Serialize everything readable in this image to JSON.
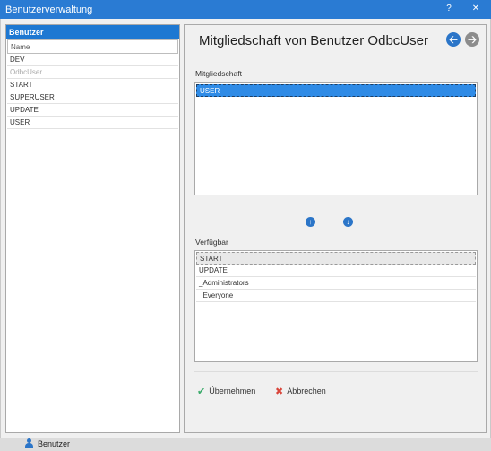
{
  "window": {
    "title": "Benutzerverwaltung",
    "help_label": "?",
    "close_label": "✕"
  },
  "left": {
    "header": "Benutzer",
    "column_header": "Name",
    "rows": [
      "DEV",
      "OdbcUser",
      "START",
      "SUPERUSER",
      "UPDATE",
      "USER"
    ]
  },
  "right": {
    "title": "Mitgliedschaft von Benutzer OdbcUser",
    "nav_back": "🡠",
    "nav_forward": "🡢",
    "membership_label": "Mitgliedschaft",
    "membership_items": [
      "USER"
    ],
    "move_up": "↑",
    "move_down": "↓",
    "available_label": "Verfügbar",
    "available_items": [
      "START",
      "UPDATE",
      "_Administrators",
      "_Everyone"
    ],
    "apply_label": "Übernehmen",
    "apply_icon": "✔",
    "cancel_label": "Abbrechen",
    "cancel_icon": "✖"
  },
  "statusbar": {
    "item_label": "Benutzer"
  },
  "colors": {
    "accent": "#2a7bd3",
    "selection": "#2f8be6",
    "ok": "#3aaa6a",
    "cancel": "#d9453a"
  }
}
